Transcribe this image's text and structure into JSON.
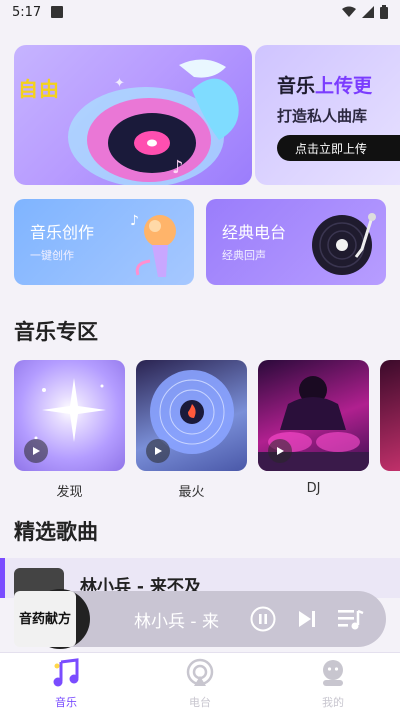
{
  "status": {
    "time": "5:17"
  },
  "banner": {
    "left_word": "自由",
    "right_title_a": "音乐",
    "right_title_b": "上传更",
    "right_subtitle": "打造私人曲库",
    "right_button": "点击立即上传"
  },
  "features": [
    {
      "title": "音乐创作",
      "subtitle": "一键创作"
    },
    {
      "title": "经典电台",
      "subtitle": "经典回声"
    }
  ],
  "music_zone": {
    "title": "音乐专区",
    "items": [
      {
        "label": "发现"
      },
      {
        "label": "最火"
      },
      {
        "label": "DJ"
      }
    ]
  },
  "featured_songs": {
    "title": "精选歌曲",
    "first_song": "林小兵 - 来不及"
  },
  "player": {
    "cover_text": "音药献方",
    "now_playing": "林小兵 - 来"
  },
  "tabs": [
    {
      "label": "音乐",
      "active": true
    },
    {
      "label": "电台",
      "active": false
    },
    {
      "label": "我的",
      "active": false
    }
  ],
  "colors": {
    "accent": "#7a4cff",
    "inactive": "#c8c6cf"
  }
}
